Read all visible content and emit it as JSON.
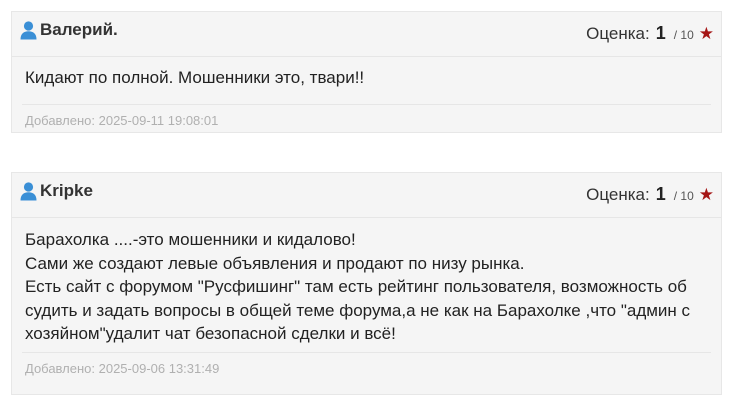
{
  "reviews": [
    {
      "author": "Валерий.",
      "rating_label": "Оценка:",
      "rating_value": "1",
      "rating_max": "/ 10",
      "text_lines": [
        "Кидают по полной. Мошенники это, твари!!"
      ],
      "added": "Добавлено: 2025-09-11 19:08:01"
    },
    {
      "author": "Kripke",
      "rating_label": "Оценка:",
      "rating_value": "1",
      "rating_max": "/ 10",
      "text_lines": [
        "Барахолка ....-это мошенники и кидалово!",
        "Сами же создают левые объявления и продают по низу рынка.",
        "Есть сайт с форумом \"Русфишинг\" там есть рейтинг пользователя, возможность об",
        "судить и задать вопросы в общей теме форума,а не как на Барахолке ,что \"админ с",
        "хозяйном\"удалит чат безопасной сделки и всё!"
      ],
      "added": "Добавлено: 2025-09-06 13:31:49"
    }
  ],
  "icons": {
    "user": "user-icon",
    "star": "star-icon"
  },
  "colors": {
    "user_icon": "#3a8fd6",
    "star": "#a51515",
    "card_bg": "#f5f5f5",
    "muted_text": "#b0b0b0"
  }
}
